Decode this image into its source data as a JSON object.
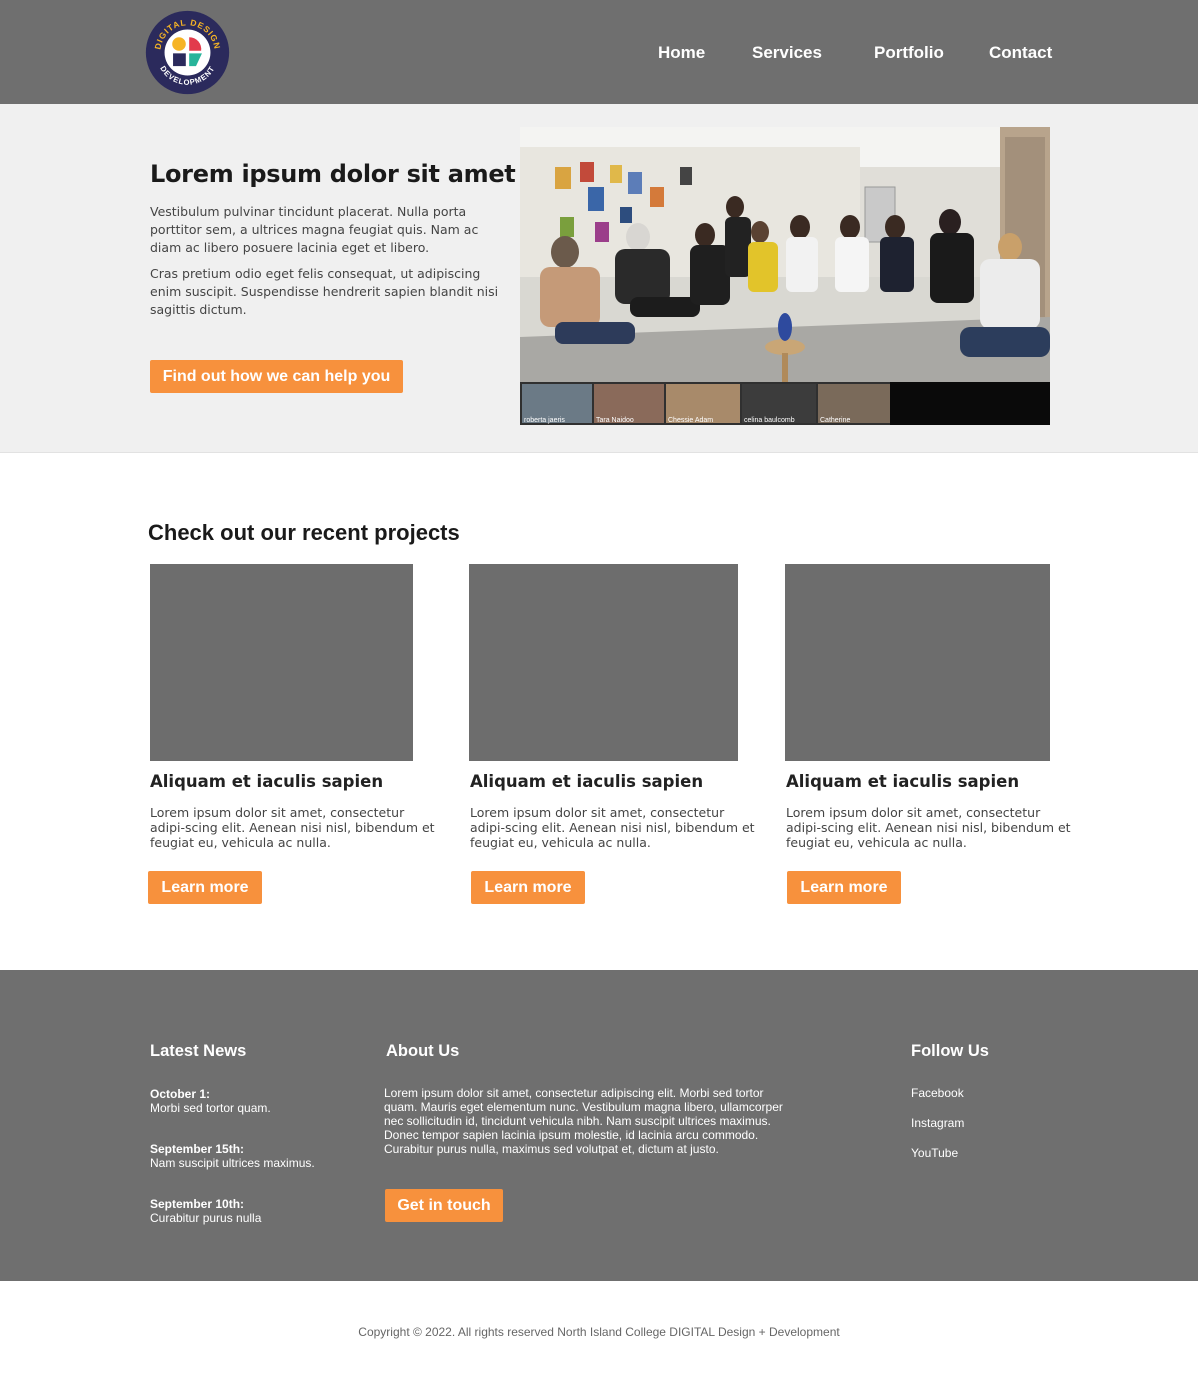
{
  "header": {
    "logo": {
      "top_text": "DIGITAL DESIGN",
      "bottom_text": "DEVELOPMENT",
      "colors": {
        "ring": "#2b2a5c",
        "yellow": "#f6b425",
        "red": "#e23b4c",
        "green": "#27b49a",
        "blue": "#2b2a5c"
      }
    },
    "nav": [
      {
        "label": "Home"
      },
      {
        "label": "Services"
      },
      {
        "label": "Portfolio"
      },
      {
        "label": "Contact"
      }
    ]
  },
  "hero": {
    "title": "Lorem ipsum dolor sit amet",
    "paragraph1": "Vestibulum pulvinar tincidunt placerat. Nulla porta porttitor sem, a ultrices magna feugiat quis. Nam ac diam ac libero posuere lacinia eget et libero.",
    "paragraph2": "Cras pretium odio eget felis consequat, ut adipiscing enim suscipit. Suspendisse hendrerit sapien blandit nisi sagittis dictum.",
    "cta_label": "Find out how we can help you",
    "photo_participants": [
      "roberta jaeris",
      "Tara Naidoo",
      "Chessie Adam",
      "celina baulcomb",
      "Catherine"
    ]
  },
  "projects": {
    "heading": "Check out our recent projects",
    "cards": [
      {
        "title": "Aliquam et iaculis sapien",
        "text": "Lorem ipsum dolor sit amet, consectetur adipi-scing elit. Aenean nisi nisl, bibendum et feugiat eu, vehicula ac nulla.",
        "button": "Learn more"
      },
      {
        "title": "Aliquam et iaculis sapien",
        "text": "Lorem ipsum dolor sit amet, consectetur adipi-scing elit. Aenean nisi nisl, bibendum et feugiat eu, vehicula ac nulla.",
        "button": "Learn more"
      },
      {
        "title": "Aliquam et iaculis sapien",
        "text": "Lorem ipsum dolor sit amet, consectetur adipi-scing elit. Aenean nisi nisl, bibendum et feugiat eu, vehicula ac nulla.",
        "button": "Learn more"
      }
    ]
  },
  "footer": {
    "news": {
      "heading": "Latest News",
      "items": [
        {
          "date": "October 1:",
          "text": "Morbi sed tortor quam."
        },
        {
          "date": "September 15th:",
          "text": "Nam suscipit ultrices maximus."
        },
        {
          "date": "September 10th:",
          "text": "Curabitur purus nulla"
        }
      ]
    },
    "about": {
      "heading": "About Us",
      "text": "Lorem ipsum dolor sit amet, consectetur adipiscing elit. Morbi sed tortor quam. Mauris eget elementum nunc. Vestibulum magna libero, ullamcorper nec sollicitudin id, tincidunt vehicula nibh. Nam suscipit ultrices maximus. Donec tempor sapien lacinia ipsum molestie, id lacinia arcu commodo. Curabitur purus nulla, maximus sed volutpat et, dictum at justo.",
      "button": "Get in touch"
    },
    "follow": {
      "heading": "Follow Us",
      "links": [
        {
          "label": "Facebook"
        },
        {
          "label": "Instagram"
        },
        {
          "label": "YouTube"
        }
      ]
    }
  },
  "copyright": "Copyright © 2022. All rights reserved North Island College DIGITAL Design + Development",
  "colors": {
    "header_bg": "#6f6f6f",
    "accent": "#f7913d",
    "hero_bg": "#f0f0f0"
  }
}
